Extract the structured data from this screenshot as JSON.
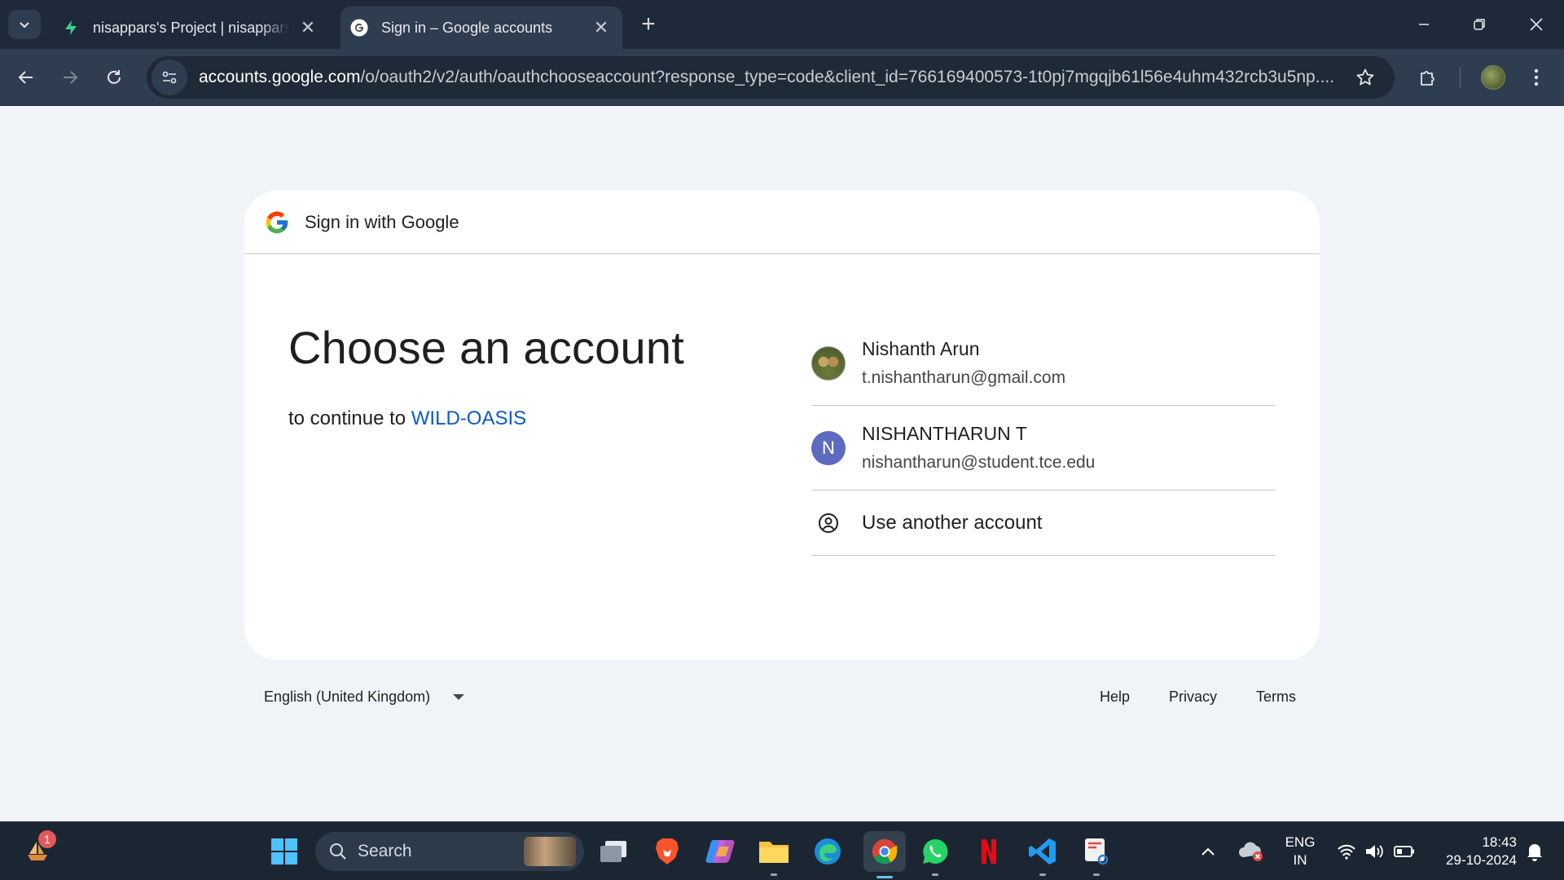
{
  "browser": {
    "tabs": [
      {
        "title": "nisappars's Project | nisappars's",
        "active": false,
        "icon": "supabase-bolt-icon"
      },
      {
        "title": "Sign in – Google accounts",
        "active": true,
        "icon": "google-g-icon"
      }
    ],
    "url_host": "accounts.google.com",
    "url_path": "/o/oauth2/v2/auth/oauthchooseaccount?response_type=code&client_id=766169400573-1t0pj7mgqjb61l56e4uhm432rcb3u5np...."
  },
  "page": {
    "header": "Sign in with Google",
    "title": "Choose an account",
    "continue_prefix": "to continue to",
    "app_name": "WILD-OASIS",
    "accounts": [
      {
        "name": "Nishanth Arun",
        "email": "t.nishantharun@gmail.com",
        "avatar": "photo"
      },
      {
        "name": "NISHANTHARUN T",
        "email": "nishantharun@student.tce.edu",
        "avatar_letter": "N"
      }
    ],
    "use_another": "Use another account",
    "language": "English (United Kingdom)",
    "footer_links": [
      "Help",
      "Privacy",
      "Terms"
    ]
  },
  "taskbar": {
    "search_label": "Search",
    "notification_count": "1",
    "lang_top": "ENG",
    "lang_bottom": "IN",
    "time": "18:43",
    "date": "29-10-2024"
  },
  "colors": {
    "accent_link": "#0b57d0",
    "page_bg": "#f0f4f9",
    "chrome_dark": "#1e2a3a",
    "avatar_letter_bg": "#5c6bc0"
  }
}
